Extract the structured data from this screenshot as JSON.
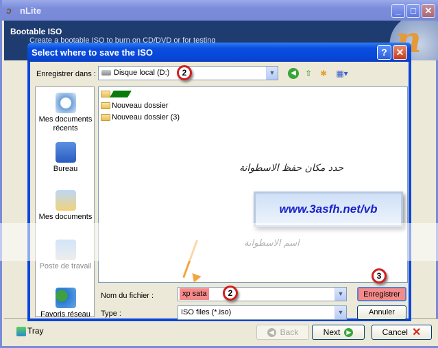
{
  "outer_window": {
    "title": "nLite",
    "banner_title": "Bootable ISO",
    "banner_subtitle": "Create a bootable ISO to burn on CD/DVD or for testing",
    "minimize": "_",
    "maximize": "□",
    "close": "✕"
  },
  "dialog": {
    "title": "Select where to save the ISO",
    "help": "?",
    "close": "✕",
    "save_in_label": "Enregistrer dans :",
    "save_in_value": "Disque local (D:)",
    "places": [
      {
        "label": "Mes documents récents",
        "icon": "recent-documents-icon"
      },
      {
        "label": "Bureau",
        "icon": "desktop-icon"
      },
      {
        "label": "Mes documents",
        "icon": "my-documents-icon"
      },
      {
        "label": "Poste de travail",
        "icon": "my-computer-icon"
      },
      {
        "label": "Favoris réseau",
        "icon": "network-places-icon"
      }
    ],
    "files": [
      {
        "name": ""
      },
      {
        "name": "Nouveau dossier"
      },
      {
        "name": "Nouveau dossier (3)"
      }
    ],
    "filename_label": "Nom du fichier :",
    "filename_value": "xp sata",
    "type_label": "Type :",
    "type_value": "ISO files (*.iso)",
    "save_button": "Enregistrer",
    "cancel_button": "Annuler"
  },
  "annotations": {
    "instruction_select_location": "حدد مكان حفظ الاسطوانة",
    "website": "www.3asfh.net/vb",
    "instruction_disc_name": "اسم الاسطوانة",
    "marker_drive": "2",
    "marker_filename": "2",
    "marker_save": "3"
  },
  "footer": {
    "tray": "Tray",
    "back": "Back",
    "next": "Next",
    "cancel": "Cancel"
  }
}
